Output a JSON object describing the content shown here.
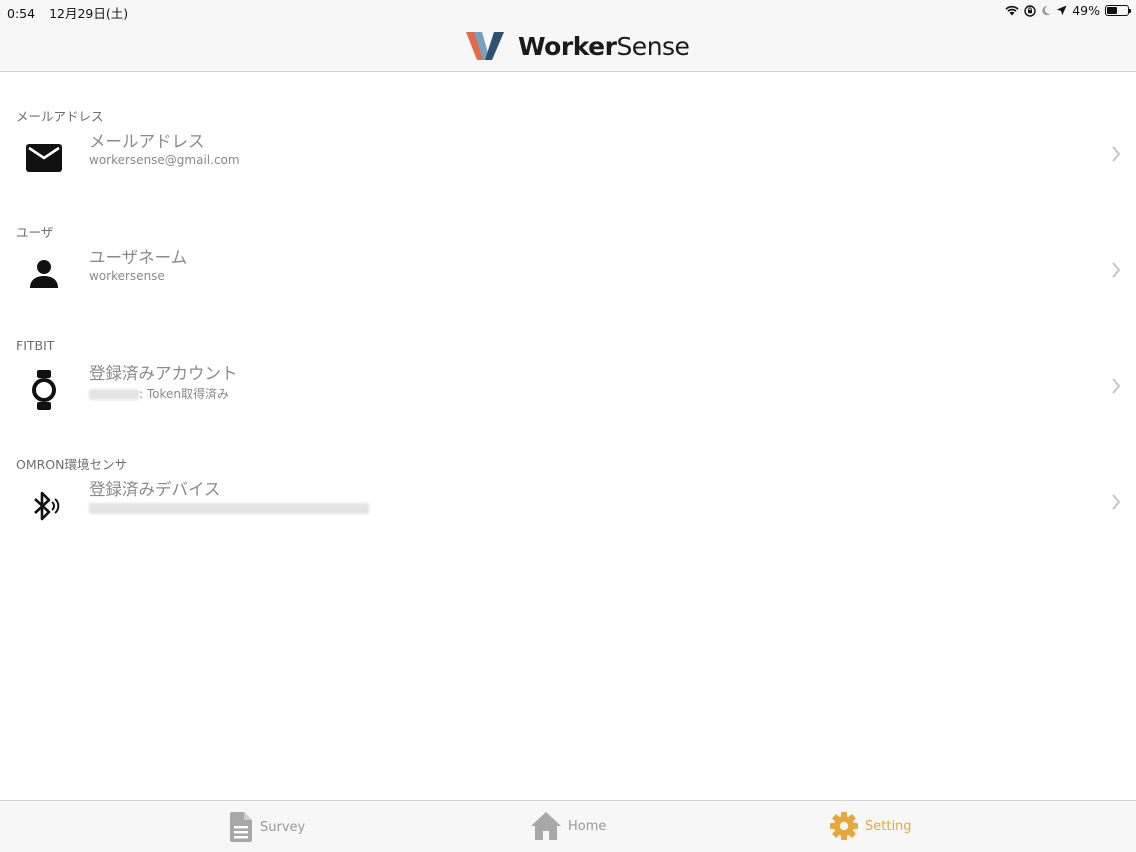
{
  "status_bar": {
    "time": "0:54",
    "date": "12月29日(土)",
    "battery": "49%",
    "battery_level": 0.49
  },
  "header": {
    "brand_bold": "Worker",
    "brand_light": "Sense",
    "logo_colors": [
      "#e46a4a",
      "#2f4f73",
      "#7aa0bf"
    ]
  },
  "sections": [
    {
      "label": "メールアドレス",
      "title": "メールアドレス",
      "subtitle": "workersense@gmail.com",
      "icon": "mail-icon"
    },
    {
      "label": "ユーザ",
      "title": "ユーザネーム",
      "subtitle": "workersense",
      "icon": "person-icon"
    },
    {
      "label": "FITBIT",
      "title": "登録済みアカウント",
      "subtitle": ": Token取得済み",
      "icon": "watch-icon"
    },
    {
      "label": "OMRON環境センサ",
      "title": "登録済みデバイス",
      "subtitle": "",
      "icon": "bluetooth-searching-icon"
    }
  ],
  "tabs": [
    {
      "label": "Survey",
      "icon": "document-icon",
      "active": false
    },
    {
      "label": "Home",
      "icon": "home-icon",
      "active": false
    },
    {
      "label": "Setting",
      "icon": "gear-icon",
      "active": true
    }
  ],
  "colors": {
    "accent": "#e7a73a",
    "inactive": "#9a9a9a"
  }
}
